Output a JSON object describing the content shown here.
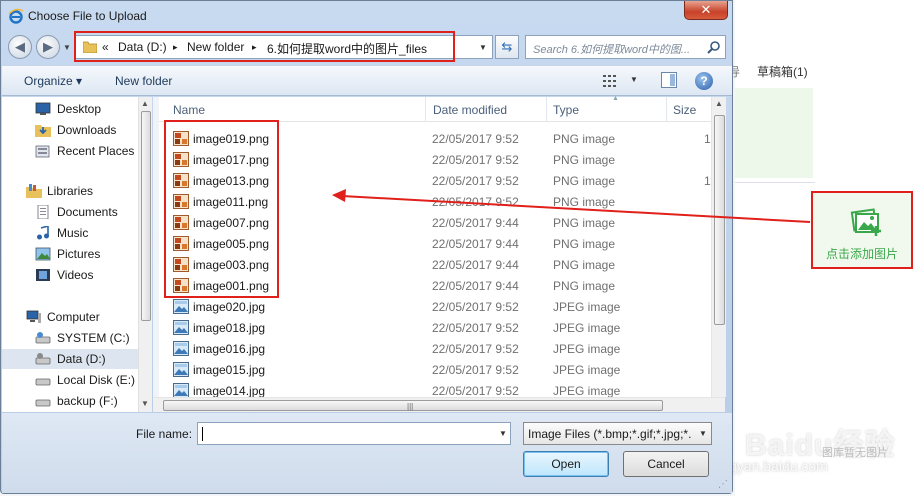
{
  "dialog": {
    "title": "Choose File to Upload",
    "close_label": "✕"
  },
  "address": {
    "prefix": "«",
    "segments": [
      "Data (D:)",
      "New folder",
      "6.如何提取word中的图片_files"
    ],
    "separator": "▸"
  },
  "search": {
    "placeholder": "Search 6.如何提取word中的图..."
  },
  "toolbar": {
    "organize": "Organize ▾",
    "new_folder": "New folder",
    "help": "?"
  },
  "nav": {
    "items": [
      {
        "label": "Desktop",
        "icon": "desktop-icon"
      },
      {
        "label": "Downloads",
        "icon": "downloads-icon"
      },
      {
        "label": "Recent Places",
        "icon": "recent-places-icon"
      },
      {
        "label": "Libraries",
        "icon": "libraries-icon"
      },
      {
        "label": "Documents",
        "icon": "documents-icon"
      },
      {
        "label": "Music",
        "icon": "music-icon"
      },
      {
        "label": "Pictures",
        "icon": "pictures-icon"
      },
      {
        "label": "Videos",
        "icon": "videos-icon"
      },
      {
        "label": "Computer",
        "icon": "computer-icon"
      },
      {
        "label": "SYSTEM (C:)",
        "icon": "drive-icon"
      },
      {
        "label": "Data (D:)",
        "icon": "drive-icon"
      },
      {
        "label": "Local Disk (E:)",
        "icon": "drive-icon"
      },
      {
        "label": "backup (F:)",
        "icon": "drive-icon"
      }
    ]
  },
  "columns": {
    "name": "Name",
    "date": "Date modified",
    "type": "Type",
    "size": "Size"
  },
  "files": [
    {
      "name": "image019.png",
      "date": "22/05/2017 9:52",
      "type": "PNG image",
      "size": "1"
    },
    {
      "name": "image017.png",
      "date": "22/05/2017 9:52",
      "type": "PNG image",
      "size": ""
    },
    {
      "name": "image013.png",
      "date": "22/05/2017 9:52",
      "type": "PNG image",
      "size": "1"
    },
    {
      "name": "image011.png",
      "date": "22/05/2017 9:52",
      "type": "PNG image",
      "size": ""
    },
    {
      "name": "image007.png",
      "date": "22/05/2017 9:44",
      "type": "PNG image",
      "size": ""
    },
    {
      "name": "image005.png",
      "date": "22/05/2017 9:44",
      "type": "PNG image",
      "size": ""
    },
    {
      "name": "image003.png",
      "date": "22/05/2017 9:44",
      "type": "PNG image",
      "size": ""
    },
    {
      "name": "image001.png",
      "date": "22/05/2017 9:44",
      "type": "PNG image",
      "size": ""
    },
    {
      "name": "image020.jpg",
      "date": "22/05/2017 9:52",
      "type": "JPEG image",
      "size": ""
    },
    {
      "name": "image018.jpg",
      "date": "22/05/2017 9:52",
      "type": "JPEG image",
      "size": ""
    },
    {
      "name": "image016.jpg",
      "date": "22/05/2017 9:52",
      "type": "JPEG image",
      "size": ""
    },
    {
      "name": "image015.jpg",
      "date": "22/05/2017 9:52",
      "type": "JPEG image",
      "size": ""
    },
    {
      "name": "image014.jpg",
      "date": "22/05/2017 9:52",
      "type": "JPEG image",
      "size": ""
    }
  ],
  "bottom": {
    "filename_label": "File name:",
    "filename_value": "",
    "filetype": "Image Files (*.bmp;*.gif;*.jpg;*.",
    "open": "Open",
    "cancel": "Cancel"
  },
  "background": {
    "drafts": "草稿箱(1)",
    "drafts_prefix": "导",
    "upload_label": "点击添加图片",
    "watermark": "Baidu经验",
    "watermark_sub": "jingyan.baidu.com",
    "watermark_sub2": "图库暂无图片"
  },
  "colors": {
    "highlight": "#e0201a",
    "upload_green": "#3aa84a",
    "accent": "#2a5fa8"
  }
}
